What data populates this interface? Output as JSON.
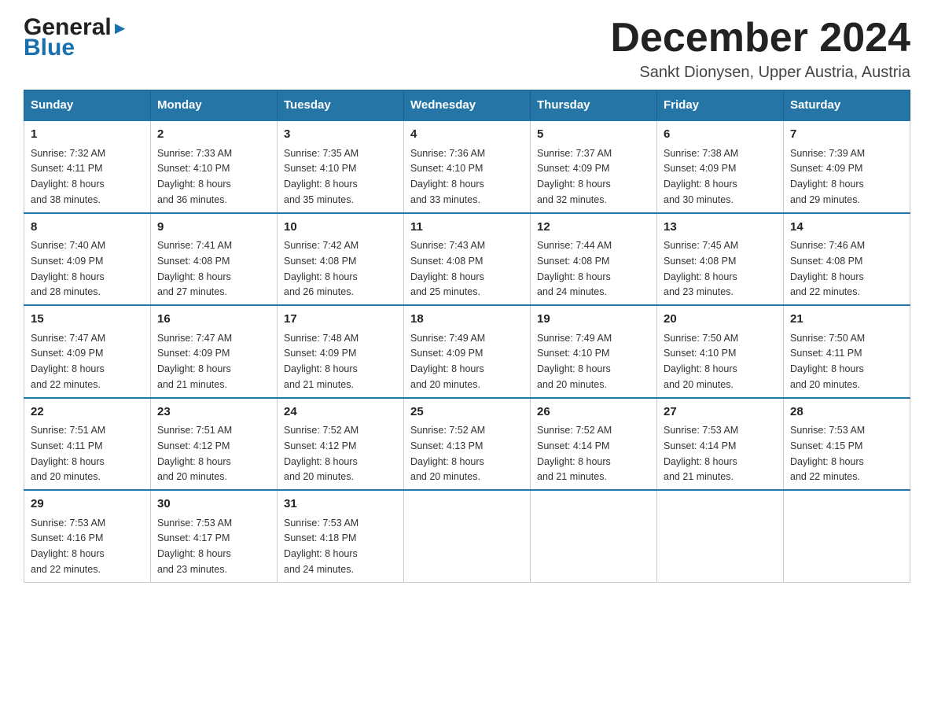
{
  "header": {
    "logo_general": "General",
    "logo_blue": "Blue",
    "month_title": "December 2024",
    "location": "Sankt Dionysen, Upper Austria, Austria"
  },
  "columns": [
    "Sunday",
    "Monday",
    "Tuesday",
    "Wednesday",
    "Thursday",
    "Friday",
    "Saturday"
  ],
  "weeks": [
    [
      {
        "day": "1",
        "sunrise": "7:32 AM",
        "sunset": "4:11 PM",
        "daylight": "8 hours and 38 minutes."
      },
      {
        "day": "2",
        "sunrise": "7:33 AM",
        "sunset": "4:10 PM",
        "daylight": "8 hours and 36 minutes."
      },
      {
        "day": "3",
        "sunrise": "7:35 AM",
        "sunset": "4:10 PM",
        "daylight": "8 hours and 35 minutes."
      },
      {
        "day": "4",
        "sunrise": "7:36 AM",
        "sunset": "4:10 PM",
        "daylight": "8 hours and 33 minutes."
      },
      {
        "day": "5",
        "sunrise": "7:37 AM",
        "sunset": "4:09 PM",
        "daylight": "8 hours and 32 minutes."
      },
      {
        "day": "6",
        "sunrise": "7:38 AM",
        "sunset": "4:09 PM",
        "daylight": "8 hours and 30 minutes."
      },
      {
        "day": "7",
        "sunrise": "7:39 AM",
        "sunset": "4:09 PM",
        "daylight": "8 hours and 29 minutes."
      }
    ],
    [
      {
        "day": "8",
        "sunrise": "7:40 AM",
        "sunset": "4:09 PM",
        "daylight": "8 hours and 28 minutes."
      },
      {
        "day": "9",
        "sunrise": "7:41 AM",
        "sunset": "4:08 PM",
        "daylight": "8 hours and 27 minutes."
      },
      {
        "day": "10",
        "sunrise": "7:42 AM",
        "sunset": "4:08 PM",
        "daylight": "8 hours and 26 minutes."
      },
      {
        "day": "11",
        "sunrise": "7:43 AM",
        "sunset": "4:08 PM",
        "daylight": "8 hours and 25 minutes."
      },
      {
        "day": "12",
        "sunrise": "7:44 AM",
        "sunset": "4:08 PM",
        "daylight": "8 hours and 24 minutes."
      },
      {
        "day": "13",
        "sunrise": "7:45 AM",
        "sunset": "4:08 PM",
        "daylight": "8 hours and 23 minutes."
      },
      {
        "day": "14",
        "sunrise": "7:46 AM",
        "sunset": "4:08 PM",
        "daylight": "8 hours and 22 minutes."
      }
    ],
    [
      {
        "day": "15",
        "sunrise": "7:47 AM",
        "sunset": "4:09 PM",
        "daylight": "8 hours and 22 minutes."
      },
      {
        "day": "16",
        "sunrise": "7:47 AM",
        "sunset": "4:09 PM",
        "daylight": "8 hours and 21 minutes."
      },
      {
        "day": "17",
        "sunrise": "7:48 AM",
        "sunset": "4:09 PM",
        "daylight": "8 hours and 21 minutes."
      },
      {
        "day": "18",
        "sunrise": "7:49 AM",
        "sunset": "4:09 PM",
        "daylight": "8 hours and 20 minutes."
      },
      {
        "day": "19",
        "sunrise": "7:49 AM",
        "sunset": "4:10 PM",
        "daylight": "8 hours and 20 minutes."
      },
      {
        "day": "20",
        "sunrise": "7:50 AM",
        "sunset": "4:10 PM",
        "daylight": "8 hours and 20 minutes."
      },
      {
        "day": "21",
        "sunrise": "7:50 AM",
        "sunset": "4:11 PM",
        "daylight": "8 hours and 20 minutes."
      }
    ],
    [
      {
        "day": "22",
        "sunrise": "7:51 AM",
        "sunset": "4:11 PM",
        "daylight": "8 hours and 20 minutes."
      },
      {
        "day": "23",
        "sunrise": "7:51 AM",
        "sunset": "4:12 PM",
        "daylight": "8 hours and 20 minutes."
      },
      {
        "day": "24",
        "sunrise": "7:52 AM",
        "sunset": "4:12 PM",
        "daylight": "8 hours and 20 minutes."
      },
      {
        "day": "25",
        "sunrise": "7:52 AM",
        "sunset": "4:13 PM",
        "daylight": "8 hours and 20 minutes."
      },
      {
        "day": "26",
        "sunrise": "7:52 AM",
        "sunset": "4:14 PM",
        "daylight": "8 hours and 21 minutes."
      },
      {
        "day": "27",
        "sunrise": "7:53 AM",
        "sunset": "4:14 PM",
        "daylight": "8 hours and 21 minutes."
      },
      {
        "day": "28",
        "sunrise": "7:53 AM",
        "sunset": "4:15 PM",
        "daylight": "8 hours and 22 minutes."
      }
    ],
    [
      {
        "day": "29",
        "sunrise": "7:53 AM",
        "sunset": "4:16 PM",
        "daylight": "8 hours and 22 minutes."
      },
      {
        "day": "30",
        "sunrise": "7:53 AM",
        "sunset": "4:17 PM",
        "daylight": "8 hours and 23 minutes."
      },
      {
        "day": "31",
        "sunrise": "7:53 AM",
        "sunset": "4:18 PM",
        "daylight": "8 hours and 24 minutes."
      },
      null,
      null,
      null,
      null
    ]
  ],
  "labels": {
    "sunrise": "Sunrise:",
    "sunset": "Sunset:",
    "daylight": "Daylight:"
  }
}
